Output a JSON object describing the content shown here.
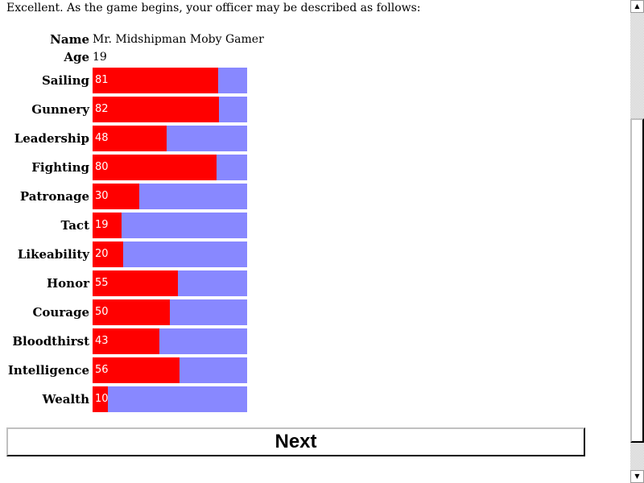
{
  "intro": "Excellent. As the game begins, your officer may be described as follows:",
  "name": {
    "label": "Name",
    "value": "Mr. Midshipman Moby Gamer"
  },
  "age": {
    "label": "Age",
    "value": "19"
  },
  "bar_colors": {
    "fill": "#ff0000",
    "remaining": "#8888ff"
  },
  "stats": [
    {
      "label": "Sailing",
      "value": 81
    },
    {
      "label": "Gunnery",
      "value": 82
    },
    {
      "label": "Leadership",
      "value": 48
    },
    {
      "label": "Fighting",
      "value": 80
    },
    {
      "label": "Patronage",
      "value": 30
    },
    {
      "label": "Tact",
      "value": 19
    },
    {
      "label": "Likeability",
      "value": 20
    },
    {
      "label": "Honor",
      "value": 55
    },
    {
      "label": "Courage",
      "value": 50
    },
    {
      "label": "Bloodthirst",
      "value": 43
    },
    {
      "label": "Intelligence",
      "value": 56
    },
    {
      "label": "Wealth",
      "value": 10
    }
  ],
  "next_label": "Next",
  "scrollbar": {
    "up_icon": "arrow-up-icon",
    "down_icon": "arrow-down-icon"
  }
}
